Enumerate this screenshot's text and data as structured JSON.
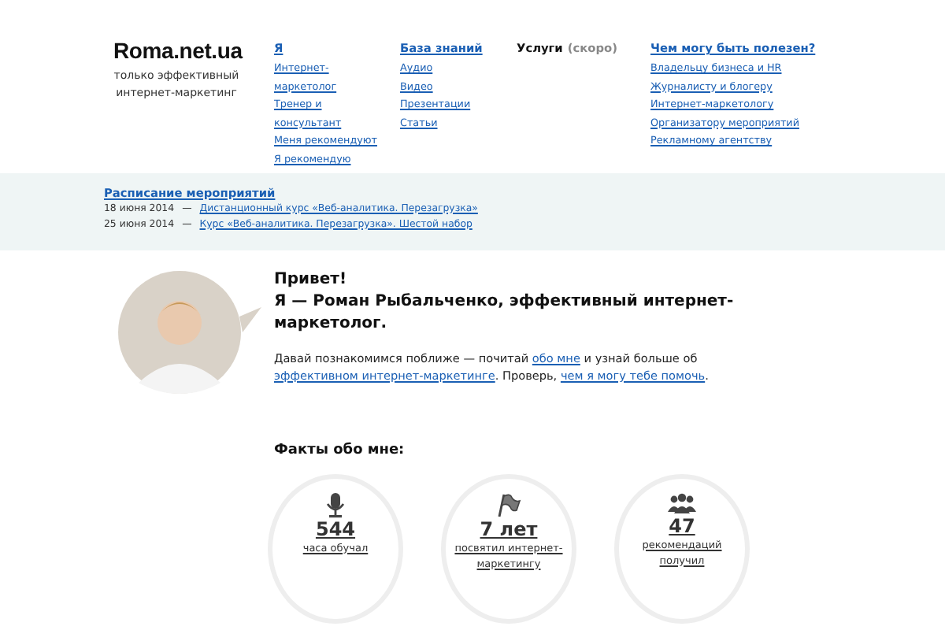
{
  "logo": {
    "title": "Roma.net.ua",
    "tagline": "только эффективный интернет-маркетинг"
  },
  "nav": [
    {
      "title": "Я",
      "link": true,
      "items": [
        "Интернет-маркетолог",
        "Тренер и консультант",
        "Меня рекомендуют",
        "Я рекомендую"
      ]
    },
    {
      "title": "База знаний",
      "link": true,
      "items": [
        "Аудио",
        "Видео",
        "Презентации",
        "Статьи"
      ]
    },
    {
      "title": "Услуги",
      "link": false,
      "note": "(скоро)"
    },
    {
      "title": "Чем могу быть полезен?",
      "link": true,
      "items": [
        "Владельцу бизнеса и HR",
        "Журналисту и блогеру",
        "Интернет-маркетологу",
        "Организатору мероприятий",
        "Рекламному агентству"
      ]
    }
  ],
  "events": {
    "title": "Расписание мероприятий",
    "items": [
      {
        "date": "18 июня 2014",
        "dash": "—",
        "title": "Дистанционный курс «Веб-аналитика. Перезагрузка»"
      },
      {
        "date": "25 июня 2014",
        "dash": "—",
        "title": "Курс «Веб-аналитика. Перезагрузка». Шестой набор"
      }
    ]
  },
  "intro": {
    "greeting": "Привет!",
    "headline": "Я — Роман Рыбальченко, эффективный интернет-маркетолог.",
    "text": [
      {
        "text": "Давай познакомимся поближе — почитай ",
        "link": false
      },
      {
        "text": "обо мне",
        "link": true
      },
      {
        "text": " и узнай больше об ",
        "link": false
      },
      {
        "text": "эффективном интернет-маркетинге",
        "link": true
      },
      {
        "text": ". Проверь, ",
        "link": false
      },
      {
        "text": "чем я могу тебе помочь",
        "link": true
      },
      {
        "text": ".",
        "link": false
      }
    ]
  },
  "facts": {
    "title": "Факты обо мне:",
    "items": [
      {
        "kind": "mic",
        "value": "544",
        "label": "часа обучал"
      },
      {
        "kind": "flag",
        "value": "7 лет",
        "label": "посвятил интернет-маркетингу"
      },
      {
        "kind": "people",
        "value": "47",
        "label": "рекомендаций получил"
      }
    ]
  }
}
